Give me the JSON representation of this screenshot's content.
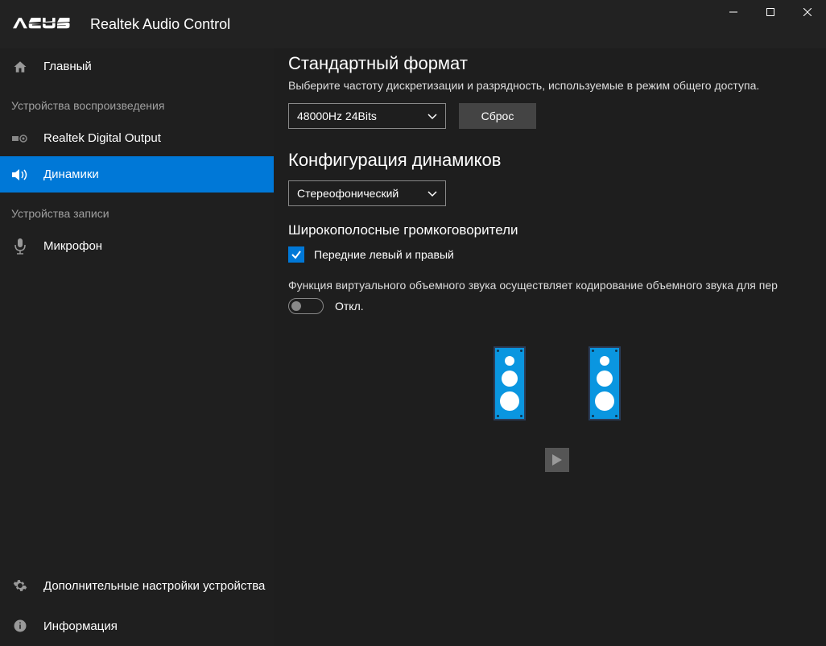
{
  "titlebar": {
    "app_title": "Realtek Audio Control"
  },
  "sidebar": {
    "main_label": "Главный",
    "section_playback": "Устройства воспроизведения",
    "item_digital": "Realtek Digital Output",
    "item_speakers": "Динамики",
    "section_record": "Устройства записи",
    "item_mic": "Микрофон",
    "item_advanced": "Дополнительные настройки устройства",
    "item_info": "Информация"
  },
  "main": {
    "format_heading": "Стандартный формат",
    "format_desc": "Выберите частоту дискретизации и разрядность, используемые в режим общего доступа.",
    "format_value": "48000Hz 24Bits",
    "reset_label": "Сброс",
    "config_heading": "Конфигурация динамиков",
    "config_value": "Стереофонический",
    "fullrange_heading": "Широкополосные громкоговорители",
    "checkbox_label": "Передние левый и правый",
    "virtual_desc": "Функция виртуального объемного звука осуществляет кодирование объемного звука для пер",
    "toggle_label": "Откл."
  }
}
